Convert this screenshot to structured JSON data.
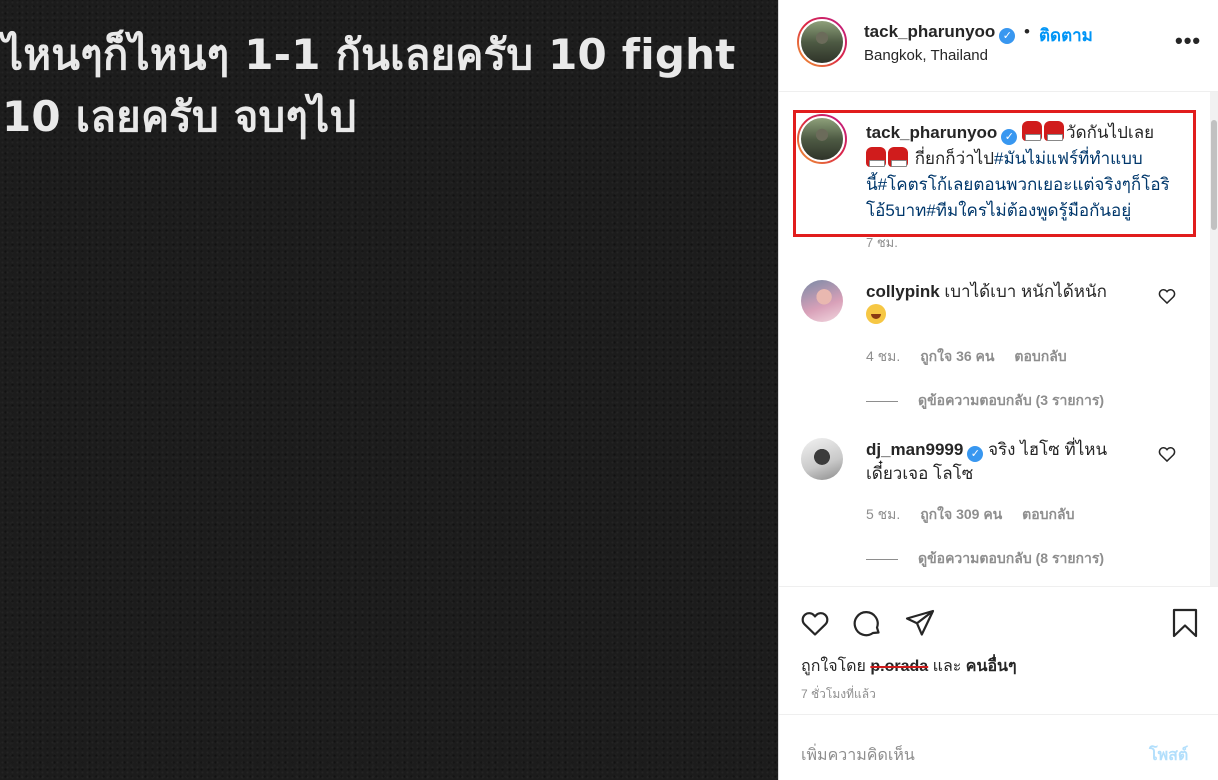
{
  "post_image": {
    "text_line1": "ไหนๆก็ไหนๆ 1-1 กันเลยครับ 10 fight",
    "text_line2": "10 เลยครับ จบๆไป"
  },
  "header": {
    "username": "tack_pharunyoo",
    "verified_icon": "verified-badge-icon",
    "separator": "•",
    "follow_label": "ติดตาม",
    "location": "Bangkok, Thailand",
    "more_label": "•••"
  },
  "caption": {
    "username": "tack_pharunyoo",
    "text_a": "วัดกันไปเลย",
    "text_b": " กี่ยกก็ว่าไป",
    "hashtags": "#มันไม่แฟร์ที่ทำแบบนี้#โคตรโก้เลยตอนพวกเยอะแต่จริงๆก็โอริโอ้5บาท#ทีมใครไม่ต้องพูดรู้มือกันอยู่",
    "time": "7 ชม.",
    "emoji": "boxing-glove-icon"
  },
  "comments": [
    {
      "username": "collypink",
      "text": "เบาได้เบา หนักได้หนัก",
      "emoji": "laughing-face-icon",
      "time": "4 ชม.",
      "likes": "ถูกใจ 36 คน",
      "reply_label": "ตอบกลับ",
      "view_replies": "ดูข้อความตอบกลับ (3 รายการ)"
    },
    {
      "username": "dj_man9999",
      "verified": true,
      "text_line1": "จริง ไฮโซ ที่ไหน",
      "text_line2": "เดี๋ยวเจอ โลโซ",
      "time": "5 ชม.",
      "likes": "ถูกใจ 309 คน",
      "reply_label": "ตอบกลับ",
      "view_replies": "ดูข้อความตอบกลับ (8 รายการ)"
    }
  ],
  "actions": {
    "liked_by_prefix": "ถูกใจโดย",
    "liked_by_user": "p.orada",
    "liked_by_and": "และ",
    "liked_by_others": "คนอื่นๆ",
    "post_time": "7 ชั่วโมงที่แล้ว"
  },
  "add_comment": {
    "placeholder": "เพิ่มความคิดเห็น",
    "post_label": "โพสต์"
  },
  "colors": {
    "accent_blue": "#0095f6",
    "hashtag_blue": "#00376b",
    "highlight_red": "#e11d1d",
    "muted_gray": "#8e8e8e"
  }
}
